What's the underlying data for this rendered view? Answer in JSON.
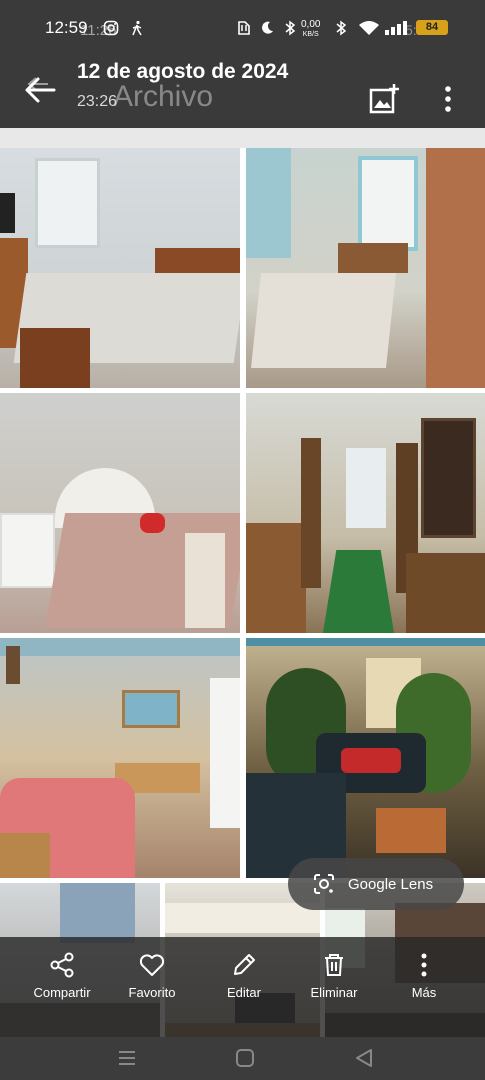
{
  "status": {
    "time": "12:59",
    "ghost_time": "11:26",
    "net_speed_value": "0,00",
    "net_speed_unit": "KB/S",
    "right_text": "59",
    "battery": "84",
    "ghost_battery": "5:0"
  },
  "header": {
    "title": "12 de agosto de 2024",
    "ghost_title": "Archivo",
    "subtitle": "23:26"
  },
  "lens": {
    "label": "Google Lens"
  },
  "actions": [
    {
      "label": "Compartir"
    },
    {
      "label": "Favorito"
    },
    {
      "label": "Editar"
    },
    {
      "label": "Eliminar"
    },
    {
      "label": "Más"
    }
  ],
  "colors": {
    "header_bg": "#3a3a3a",
    "battery": "#d7a11a",
    "bar_bg": "#282828"
  }
}
